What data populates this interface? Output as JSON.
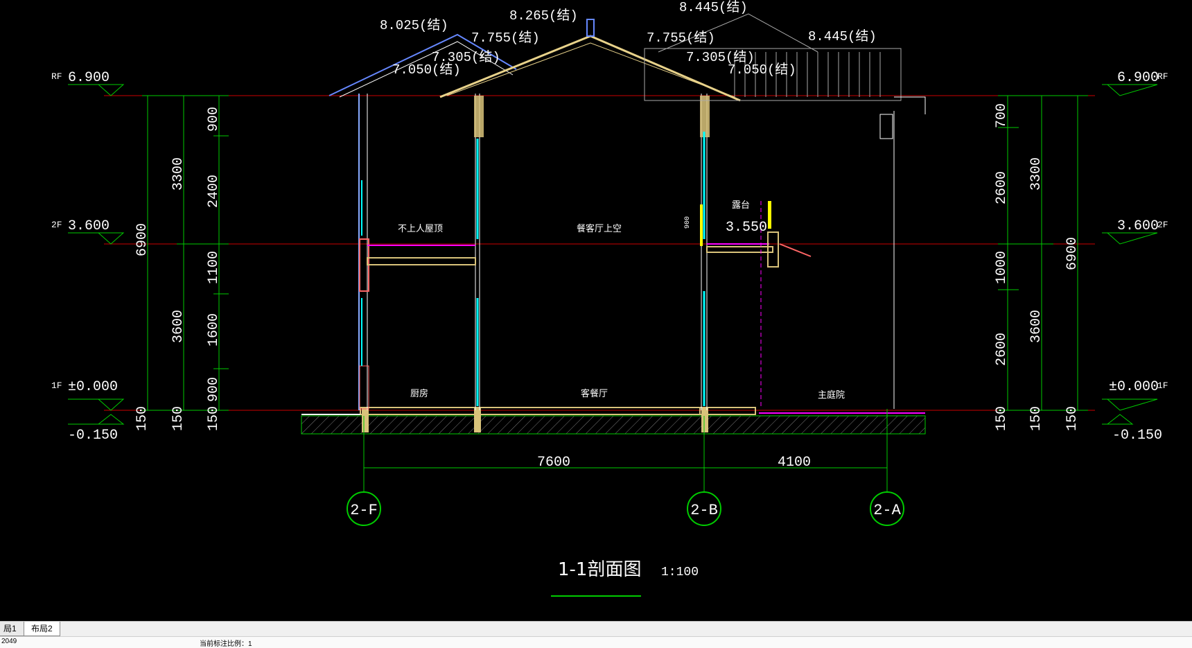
{
  "drawing": {
    "title": "1-1剖面图",
    "scale": "1:100",
    "left_levels": {
      "rf_tag": "RF",
      "rf": "6.900",
      "f2_tag": "2F",
      "f2": "3.600",
      "f1_tag": "1F",
      "f1": "±0.000",
      "ground": "-0.150"
    },
    "right_levels": {
      "rf_tag": "RF",
      "rf": "6.900",
      "f2_tag": "2F",
      "f2": "3.600",
      "f1_tag": "1F",
      "f1": "±0.000",
      "ground": "-0.150"
    },
    "left_dims": {
      "total": "6900",
      "upper": "3300",
      "lower": "3600",
      "base_a": "150",
      "seg_900_top": "900",
      "seg_2400": "2400",
      "seg_1100": "1100",
      "seg_1600": "1600",
      "seg_900_bot": "900",
      "base_b": "150",
      "base_c": "150"
    },
    "right_dims": {
      "seg_700": "700",
      "seg_2600_top": "2600",
      "seg_1000": "1000",
      "seg_2600_bot": "2600",
      "base_a": "150",
      "upper": "3300",
      "lower": "3600",
      "base_b": "150",
      "total": "6900",
      "base_c": "150"
    },
    "roof_elevations": {
      "e1": "8.025(结)",
      "e2": "7.755(结)",
      "e3": "7.305(结)",
      "e4": "7.050(结)",
      "e5": "8.265(结)",
      "e6": "8.445(结)",
      "e7": "7.755(结)",
      "e8": "7.305(结)",
      "e9": "7.050(结)",
      "e10": "8.445(结)"
    },
    "terrace_level": "3.550",
    "terrace_height": "900",
    "rooms": {
      "r1": "不上人屋顶",
      "r2": "餐客厅上空",
      "r3": "露台",
      "r4": "厨房",
      "r5": "客餐厅",
      "r6": "主庭院"
    },
    "horizontal_dims": {
      "d1": "7600",
      "d2": "4100"
    },
    "grid_axes": {
      "a1": "2-F",
      "a2": "2-B",
      "a3": "2-A"
    },
    "colors": {
      "dim": "#00ff00",
      "level": "#ff0000",
      "wall": "#ffffff",
      "glass": "#00ffff",
      "roof": "#e8d28a",
      "slab": "#ff00ff",
      "ground": "#c8c8c8",
      "hatch": "#808080"
    }
  },
  "tabs": {
    "t1": "局1",
    "t2": "布局2"
  },
  "status": {
    "left": "2049",
    "mid": "当前标注比例：1"
  }
}
